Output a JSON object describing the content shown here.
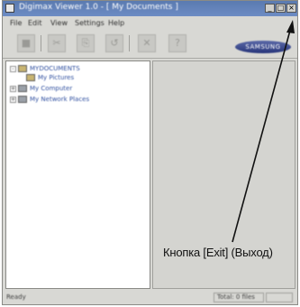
{
  "window": {
    "title": "Digimax Viewer 1.0 - [ My Documents ]",
    "controls": {
      "minimize": "_",
      "maximize": "□",
      "close": "×"
    }
  },
  "menu": [
    "File",
    "Edit",
    "View",
    "Settings",
    "Help"
  ],
  "toolbar": {
    "tools": [
      "■",
      "✂",
      "⎘",
      "↺",
      "✕",
      "?"
    ],
    "logo_text": "SAMSUNG"
  },
  "tree": {
    "items": [
      {
        "label": "MYDOCUMENTS",
        "icon": "folder-icon",
        "expander": "-"
      },
      {
        "label": "My Pictures",
        "icon": "folder-icon",
        "expander": ""
      },
      {
        "label": "My Computer",
        "icon": "computer-icon",
        "expander": "+"
      },
      {
        "label": "My Network Places",
        "icon": "network-icon",
        "expander": "+"
      }
    ]
  },
  "status": {
    "left": "Ready",
    "cells": [
      "Total: 0 files",
      ""
    ]
  },
  "annotation": {
    "label": "Кнопка [Exit] (Выход)",
    "color": "#111111"
  }
}
